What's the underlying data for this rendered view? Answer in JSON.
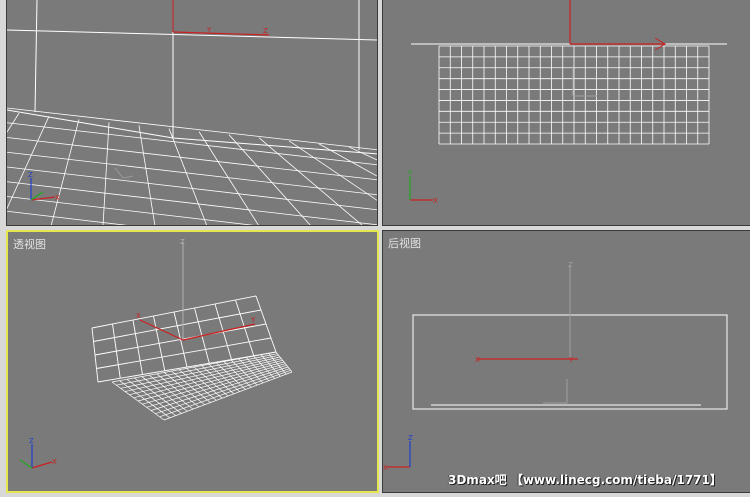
{
  "viewports": {
    "top_left": {
      "label": ""
    },
    "top_right": {
      "label": ""
    },
    "bottom_left": {
      "label": "透视图",
      "active": true
    },
    "bottom_right": {
      "label": "后视图"
    }
  },
  "watermark": {
    "text": "3Dmax吧 【www.linecg.com/tieba/1771】"
  },
  "colors": {
    "viewport_bg": "#7a7a7a",
    "active_border": "#e6e650",
    "grid_line": "#ffffff",
    "axis_x": "#cc2020",
    "axis_y": "#20aa20",
    "axis_z": "#2040cc"
  },
  "icons": [
    "xyz-axis-tripod-icon",
    "transform-gizmo-icon"
  ]
}
